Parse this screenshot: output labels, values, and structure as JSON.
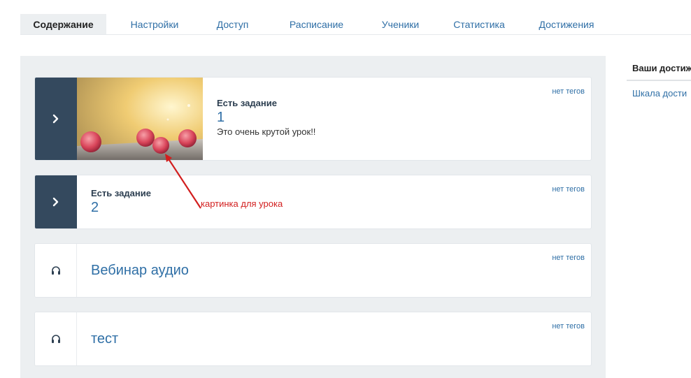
{
  "tabs": [
    {
      "label": "Содержание",
      "active": true
    },
    {
      "label": "Настройки"
    },
    {
      "label": "Доступ"
    },
    {
      "label": "Расписание"
    },
    {
      "label": "Ученики"
    },
    {
      "label": "Статистика"
    },
    {
      "label": "Достижения"
    }
  ],
  "lessons": [
    {
      "type_label": "Есть задание",
      "number": "1",
      "description": "Это очень крутой урок!!",
      "tags": "нет тегов",
      "icon": "chevron-right-icon"
    },
    {
      "type_label": "Есть задание",
      "number": "2",
      "tags": "нет тегов",
      "icon": "chevron-right-icon"
    },
    {
      "title": "Вебинар аудио",
      "tags": "нет тегов",
      "icon": "headphones-icon"
    },
    {
      "title": "тест",
      "tags": "нет тегов",
      "icon": "headphones-icon"
    }
  ],
  "annotation": {
    "text": "картинка для урока",
    "color": "#d21e1e"
  },
  "sidebar": {
    "title": "Ваши достиж",
    "link": "Шкала дости"
  },
  "colors": {
    "accent": "#2f6fa6",
    "dark_side": "#34495e",
    "panel_bg": "#eceff1"
  }
}
